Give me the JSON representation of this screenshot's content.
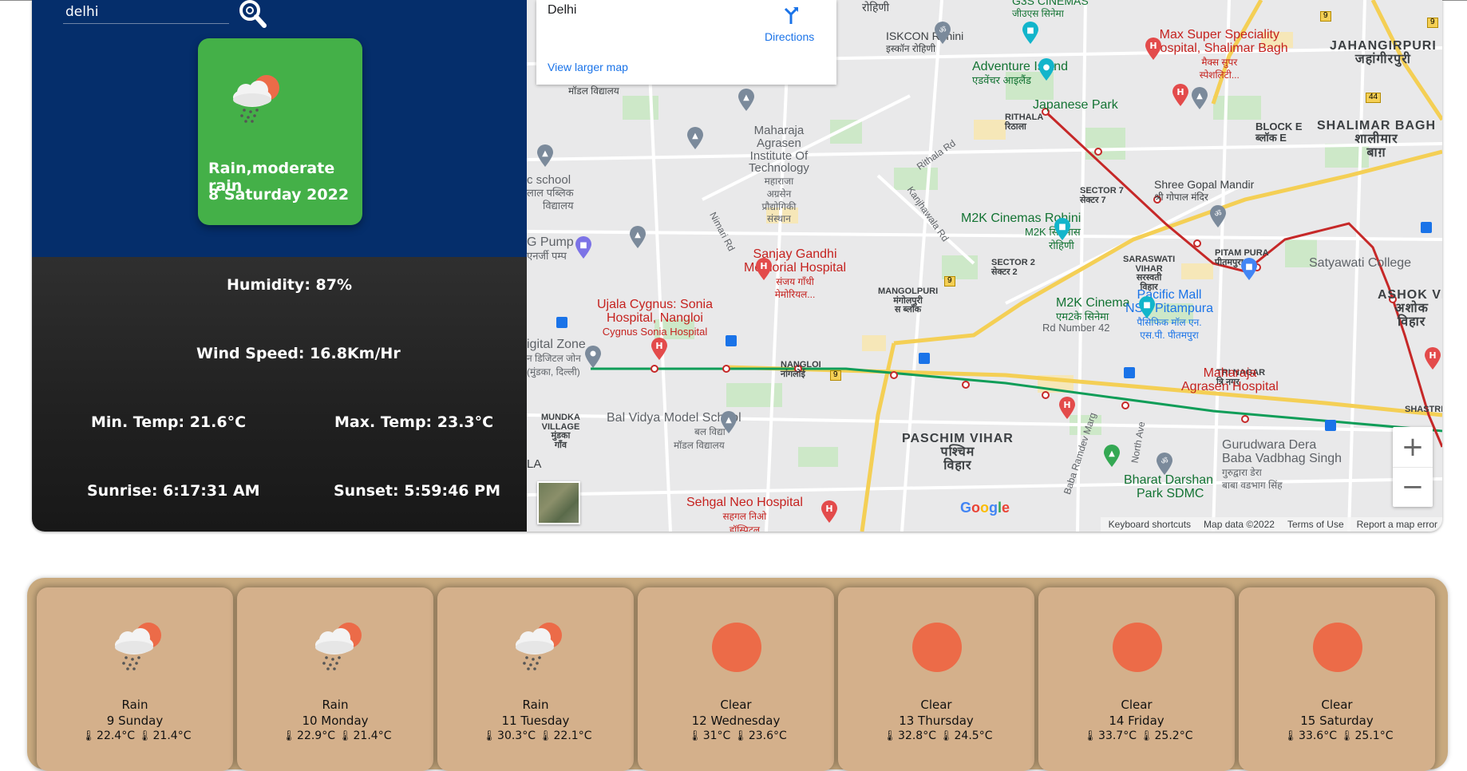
{
  "search": {
    "value": "delhi",
    "placeholder": ""
  },
  "current": {
    "description": "Rain,moderate rain",
    "date": "8 Saturday 2022",
    "humidity": "Humidity: 87%",
    "wind_speed": "Wind Speed: 16.8Km/Hr",
    "min_temp": "Min. Temp: 21.6°C",
    "max_temp": "Max. Temp: 23.3°C",
    "sunrise": "Sunrise: 6:17:31 AM",
    "sunset": "Sunset: 5:59:46 PM",
    "tile_color": "#44b048",
    "icon": "rain-cloud-sun-icon"
  },
  "map": {
    "place_name": "Delhi",
    "directions_label": "Directions",
    "view_larger_label": "View larger map",
    "footer": {
      "shortcuts": "Keyboard shortcuts",
      "data": "Map data ©2022",
      "terms": "Terms of Use",
      "report": "Report a map error"
    },
    "google": "Google",
    "labels": {
      "g3s": "G3S CINEMAS",
      "g3s_hi": "जीउएस सिनेमा",
      "rohini_hi": "रोहिणी",
      "iskcon": "ISKCON Rohini",
      "iskcon_hi": "इस्कॉन रोहिणी",
      "adventure": "Adventure Island",
      "adventure_hi": "एडवेंचर आइलैंड",
      "japanese": "Japanese Park",
      "max1": "Max Super Speciality",
      "max2": "Hospital, Shalimar Bagh",
      "max_hi1": "मैक्स सुपर",
      "max_hi2": "स्पेशलिटी...",
      "jahangirpuri": "JAHANGIRPURI",
      "jahangirpuri_hi": "जहांगीरपुरी",
      "rithala": "RITHALA",
      "rithala_hi": "रिठाला",
      "block_e": "BLOCK E",
      "block_e_hi": "ब्लॉक E",
      "shalimar": "SHALIMAR BAGH",
      "shalimar_hi1": "शालीमार",
      "shalimar_hi2": "बाग़",
      "maharaja1": "Maharaja",
      "maharaja2": "Agrasen",
      "maharaja3": "Institute Of",
      "maharaja4": "Technology",
      "maharaja_hi1": "महाराजा",
      "maharaja_hi2": "अग्रसेन",
      "maharaja_hi3": "प्रौद्योगिकी",
      "maharaja_hi4": "संस्थान",
      "rithala_rd": "Rithala Rd",
      "shree_gopal": "Shree Gopal Mandir",
      "shree_gopal_hi": "श्री गोपाल मंदिर",
      "sector7": "SECTOR 7",
      "sector7_hi": "सेक्टर 7",
      "school": "c school",
      "school_hi1": "लाल पब्लिक",
      "school_hi2": "विद्यालय",
      "kanjhawala": "Kanjhawala Rd",
      "m2k_rohini": "M2K Cinemas Rohini",
      "m2k_rohini_hi1": "M2K सिनेमास",
      "m2k_rohini_hi2": "रोहिणी",
      "nimari": "Nimari Rd",
      "pump": "G Pump",
      "pump_hi": "एनर्जी पम्प",
      "sanjay1": "Sanjay Gandhi",
      "sanjay2": "Memorial Hospital",
      "sanjay_hi1": "संजय गाँधी",
      "sanjay_hi2": "मेमोरियल...",
      "sector2": "SECTOR 2",
      "sector2_hi": "सेक्टर 2",
      "saraswati": "SARASWATI",
      "saraswati2": "VIHAR",
      "saraswati_hi1": "सरस्वती",
      "saraswati_hi2": "विहार",
      "pitam": "PITAM PURA",
      "pitam_hi": "पीतमपुरा",
      "satyawati": "Satyawati College",
      "ujala1": "Ujala Cygnus: Sonia",
      "ujala2": "Hospital, Nangloi",
      "ujala3": "Cygnus Sonia Hospital",
      "mangolpuri": "MANGOLPURI",
      "mangolpuri_hi1": "मंगोलपुरी",
      "mangolpuri_hi2": "स ब्लॉक",
      "m2k_cinema": "M2K Cinema",
      "m2k_cinema_hi": "एम2के सिनेमा",
      "pacific1": "Pacific Mall",
      "pacific2": "NSP Pitampura",
      "pacific_hi1": "पैसिफिक मॉल एन.",
      "pacific_hi2": "एस.पी. पीतमपुरा",
      "ashok": "ASHOK VI",
      "ashok_hi1": "अशोक",
      "ashok_hi2": "विहार",
      "rd42": "Rd Number 42",
      "digital": "igital Zone",
      "digital_hi1": "न डिजिटल जोन",
      "digital_hi2": "(मुंडका, दिल्ली)",
      "nangloi": "NANGLOI",
      "nangloi_hi": "नांगलोई",
      "tri_nagar": "TRI NAGAR",
      "tri_nagar_hi": "त्रि नगर",
      "maharaja_hosp1": "Maharaja",
      "maharaja_hosp2": "Agrasen Hospital",
      "shastri": "SHASTRI",
      "bal_vidya": "Bal Vidya Model School",
      "bal_vidya_hi1": "बल विद्या",
      "bal_vidya_hi2": "मॉडल विद्यालय",
      "mundka": "MUNDKA",
      "mundka2": "VILLAGE",
      "mundka_hi1": "मुंडका",
      "mundka_hi2": "गाँव",
      "paschim": "PASCHIM VIHAR",
      "paschim_hi1": "पश्चिम",
      "paschim_hi2": "विहार",
      "baba_ramdev": "Baba Ramdev Marg",
      "north_ave": "North Ave",
      "gurudwara1": "Gurudwara Dera",
      "gurudwara2": "Baba Vadbhag Singh",
      "gurudwara_hi1": "गुरुद्वारा डेरा",
      "gurudwara_hi2": "बाबा वडभाग सिंह",
      "bharat1": "Bharat Darshan",
      "bharat2": "Park SDMC",
      "sehgal": "Sehgal Neo Hospital",
      "sehgal_hi1": "सहगल निओ",
      "sehgal_hi2": "हॉस्पिटल",
      "mundka_edge": "LA",
      "vidyalaya": "मॉडल विद्यालय",
      "road9a": "9",
      "road9b": "9",
      "road9c": "9",
      "road9d": "9",
      "road44": "44"
    }
  },
  "forecast": [
    {
      "description": "Rain",
      "date": "9 Sunday",
      "max": "22.4°C",
      "min": "21.4°C",
      "icon": "rain-cloud-sun-icon"
    },
    {
      "description": "Rain",
      "date": "10 Monday",
      "max": "22.9°C",
      "min": "21.4°C",
      "icon": "rain-cloud-sun-icon"
    },
    {
      "description": "Rain",
      "date": "11 Tuesday",
      "max": "30.3°C",
      "min": "22.1°C",
      "icon": "rain-cloud-sun-icon"
    },
    {
      "description": "Clear",
      "date": "12 Wednesday",
      "max": "31°C",
      "min": "23.6°C",
      "icon": "sun-icon"
    },
    {
      "description": "Clear",
      "date": "13 Thursday",
      "max": "32.8°C",
      "min": "24.5°C",
      "icon": "sun-icon"
    },
    {
      "description": "Clear",
      "date": "14 Friday",
      "max": "33.7°C",
      "min": "25.2°C",
      "icon": "sun-icon"
    },
    {
      "description": "Clear",
      "date": "15 Saturday",
      "max": "33.6°C",
      "min": "25.1°C",
      "icon": "sun-icon"
    }
  ],
  "colors": {
    "header_bg": "#052e6b",
    "tile": "#44b048",
    "sun": "#ec6b48",
    "forecast_bg": "#c8a97e",
    "forecast_card": "#d4b08b"
  }
}
